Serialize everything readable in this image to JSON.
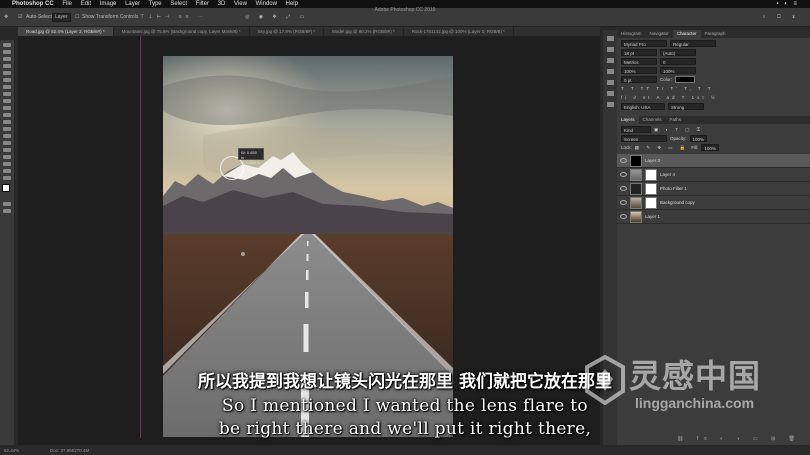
{
  "menubar": {
    "apple": "",
    "items": [
      "Photoshop CC",
      "File",
      "Edit",
      "Image",
      "Layer",
      "Type",
      "Select",
      "Filter",
      "3D",
      "View",
      "Window",
      "Help"
    ]
  },
  "window_title": "Adobe Photoshop CC 2019",
  "options": {
    "auto_select": "Auto-Select:",
    "auto_select_value": "Layer",
    "show_transform": "Show Transform Controls"
  },
  "tabs": [
    "Road.jpg @ 52.4% (Layer 2, RGB/8#) *",
    "Mountains.jpg @ 75.6% (Background copy, Layer Mask/8) *",
    "Sky.jpg @ 17.8% (RGB/8#) *",
    "Model.jpg @ 90.2% (RGB/8#) *",
    "Rock-1751142.jpg @ 100% (Layer 0, RGB/8) *"
  ],
  "transform_tip": {
    "w": "W: 0.650 in",
    "h": "H: 0.650 in"
  },
  "panels": {
    "top_tabs": [
      "Histogram",
      "Navigator",
      "Character",
      "Paragraph"
    ],
    "active_top_tab": "Character",
    "character": {
      "font": "Myriad Pro",
      "style": "Regular",
      "size": "18 pt",
      "leading": "(Auto)",
      "kerning": "Metrics",
      "tracking": "0",
      "vscale": "100%",
      "hscale": "100%",
      "baseline": "0 pt",
      "color_label": "Color:",
      "language": "English: USA",
      "aa": "Strong"
    },
    "layer_tabs": [
      "Layers",
      "Channels",
      "Paths"
    ],
    "active_layer_tab": "Layers",
    "kind": "Kind",
    "blend": "Screen",
    "opacity_label": "Opacity:",
    "opacity": "100%",
    "lock_label": "Lock:",
    "fill_label": "Fill:",
    "fill": "100%",
    "layers": [
      {
        "name": "Layer 3",
        "selected": true
      },
      {
        "name": "Layer 4",
        "selected": false
      },
      {
        "name": "Photo Filter 1",
        "selected": false
      },
      {
        "name": "Background copy",
        "selected": false
      },
      {
        "name": "Layer 1",
        "selected": false
      }
    ]
  },
  "status": {
    "zoom": "52.44%",
    "doc": "Doc: 37.8M/270.4M"
  },
  "subtitles": {
    "zh": "所以我提到我想让镜头闪光在那里 我们就把它放在那里",
    "en_line1": "So I mentioned I wanted the lens flare to",
    "en_line2": "be right there and we'll put it right there,"
  },
  "watermark": {
    "cn": "灵感中国",
    "url": "lingganchina.com"
  },
  "colors": {
    "accent_guide": "#8a3a7a",
    "panel_bg": "#3c3c3c",
    "canvas_bg": "#1e1e1e"
  }
}
